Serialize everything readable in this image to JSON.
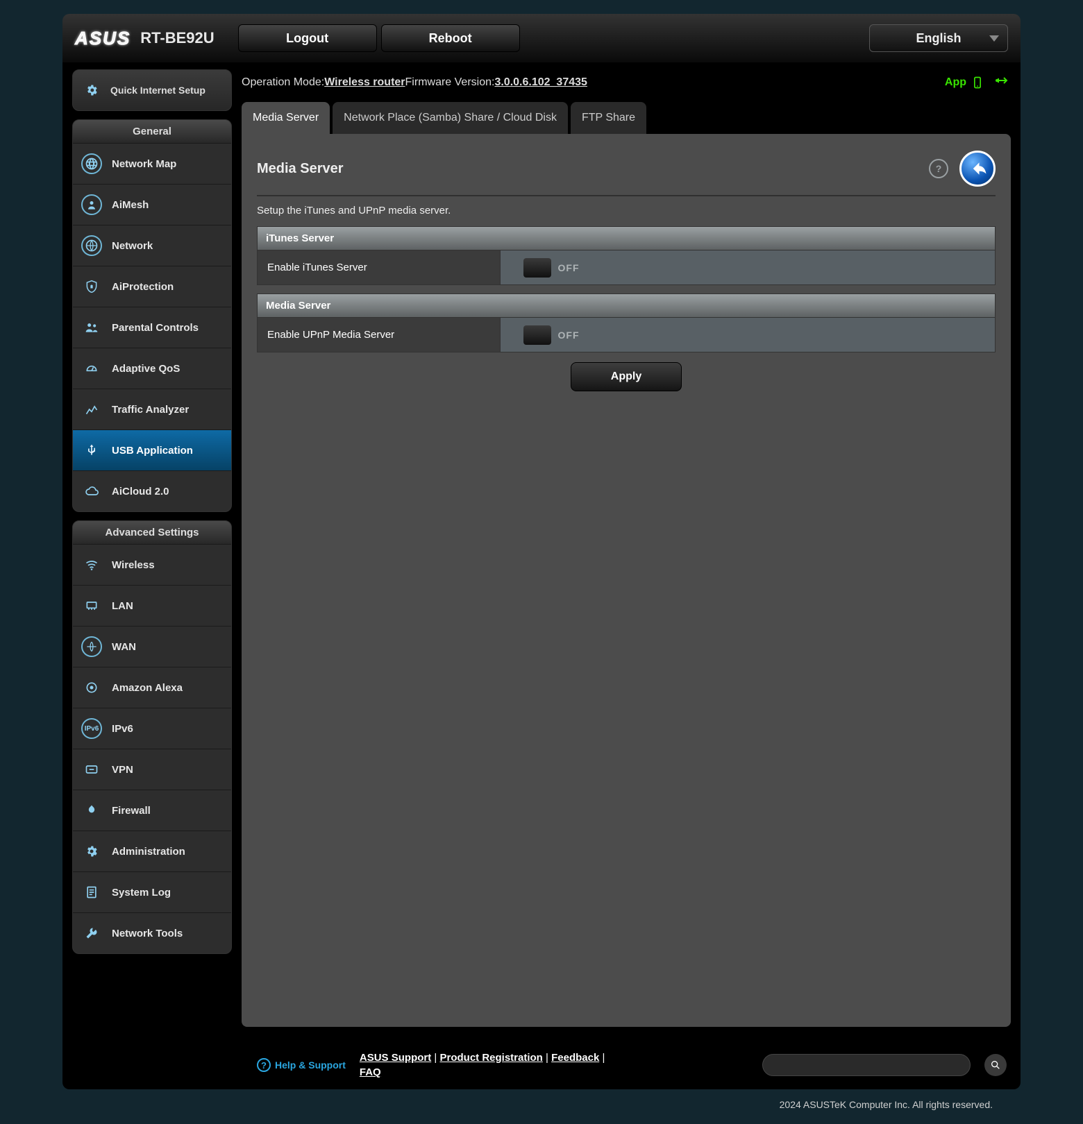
{
  "header": {
    "brand": "ASUS",
    "model": "RT-BE92U",
    "logout": "Logout",
    "reboot": "Reboot",
    "language": "English"
  },
  "status": {
    "op_mode_label": "Operation Mode: ",
    "op_mode_value": "Wireless router",
    "fw_label": " Firmware Version: ",
    "fw_value": "3.0.0.6.102_37435",
    "app_label": "App"
  },
  "sidebar": {
    "qis": "Quick Internet Setup",
    "general_label": "General",
    "general": [
      "Network Map",
      "AiMesh",
      "Network",
      "AiProtection",
      "Parental Controls",
      "Adaptive QoS",
      "Traffic Analyzer",
      "USB Application",
      "AiCloud 2.0"
    ],
    "advanced_label": "Advanced Settings",
    "advanced": [
      "Wireless",
      "LAN",
      "WAN",
      "Amazon Alexa",
      "IPv6",
      "VPN",
      "Firewall",
      "Administration",
      "System Log",
      "Network Tools"
    ]
  },
  "tabs": [
    "Media Server",
    "Network Place (Samba) Share / Cloud Disk",
    "FTP Share"
  ],
  "panel": {
    "title": "Media Server",
    "desc": "Setup the iTunes and UPnP media server.",
    "section1_header": "iTunes Server",
    "section1_row": "Enable iTunes Server",
    "section1_state": "OFF",
    "section2_header": "Media Server",
    "section2_row": "Enable UPnP Media Server",
    "section2_state": "OFF",
    "apply": "Apply",
    "help_glyph": "?"
  },
  "footer": {
    "help": "Help & Support",
    "links": {
      "asus_support": "ASUS Support",
      "product_reg": "Product Registration",
      "feedback": "Feedback",
      "faq": "FAQ"
    },
    "copyright": "2024 ASUSTeK Computer Inc. All rights reserved."
  }
}
